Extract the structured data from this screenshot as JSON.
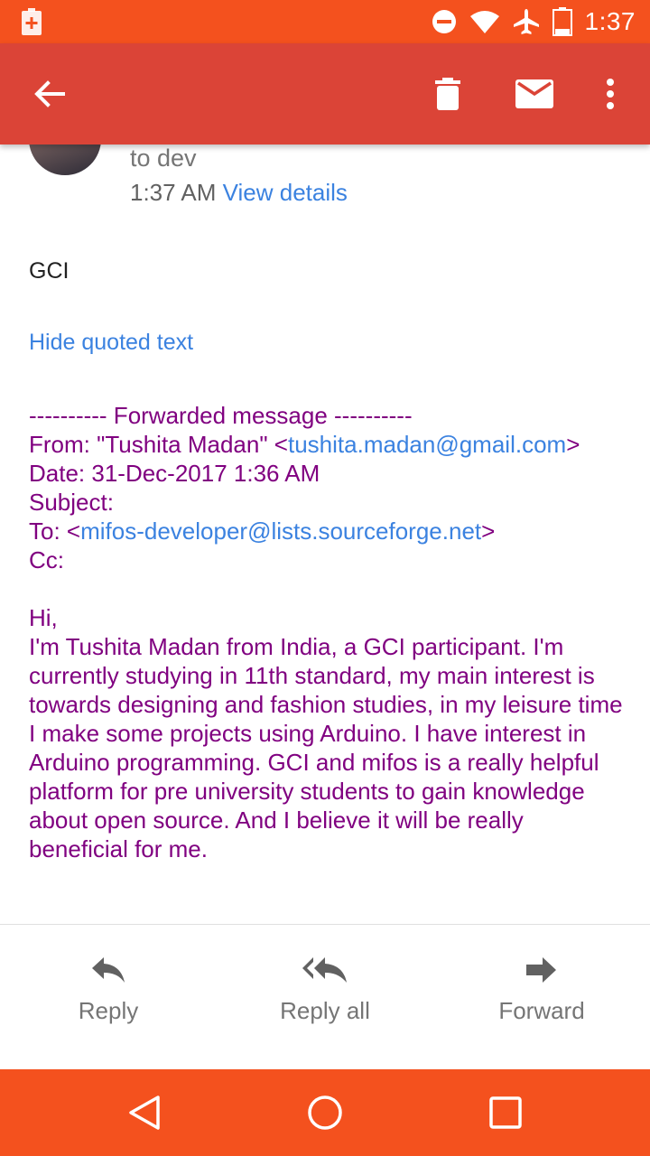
{
  "status_bar": {
    "time": "1:37",
    "battery_level": "18",
    "icons": [
      "battery-saver-icon",
      "do-not-disturb-icon",
      "wifi-icon",
      "airplane-mode-icon",
      "battery-icon"
    ],
    "color": "#f4511e"
  },
  "toolbar": {
    "color": "#db4437",
    "icons": [
      "back-arrow-icon",
      "delete-icon",
      "mail-icon",
      "more-vert-icon"
    ]
  },
  "message": {
    "recipient_line": "to dev",
    "time": "1:37 AM",
    "view_details": "View details",
    "body_text": "GCI",
    "hide_quoted": "Hide quoted text"
  },
  "quoted": {
    "header": "---------- Forwarded message ----------",
    "from_label": "From: \"Tushita Madan\" <",
    "from_email": "tushita.madan@gmail.com",
    "from_close": ">",
    "date": "Date: 31-Dec-2017 1:36 AM",
    "subject": "Subject:",
    "to_label": "To: <",
    "to_email": "mifos-developer@lists.sourceforge.net",
    "to_close": ">",
    "cc": "Cc:",
    "greeting": "Hi,",
    "body": "I'm Tushita Madan from India, a GCI participant. I'm currently studying in 11th standard, my main interest is towards designing and fashion studies, in my leisure time I make some projects using Arduino. I have interest in Arduino programming. GCI and mifos is a really helpful platform for pre university students to gain knowledge about open source. And I believe it will be really beneficial for me.",
    "text_color": "#800080",
    "link_color": "#3b82e0"
  },
  "actions": {
    "reply": "Reply",
    "reply_all": "Reply all",
    "forward": "Forward"
  },
  "navbar": {
    "icons": [
      "nav-back-icon",
      "nav-home-icon",
      "nav-recents-icon"
    ],
    "color": "#f4511e"
  }
}
